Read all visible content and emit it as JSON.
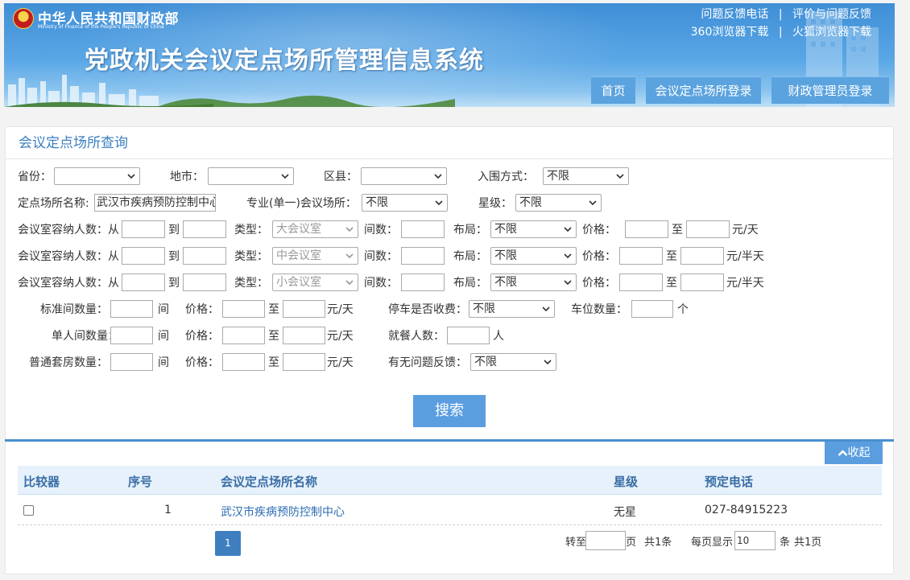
{
  "header": {
    "ministry_cn": "中华人民共和国财政部",
    "ministry_en": "Ministry of Finance of the People's Republic of China",
    "system_title": "党政机关会议定点场所管理信息系统",
    "links_row1": [
      "问题反馈电话",
      "评价与问题反馈"
    ],
    "links_row2": [
      "360浏览器下载",
      "火狐浏览器下载"
    ],
    "separator": "|",
    "nav": [
      "首页",
      "会议定点场所登录",
      "财政管理员登录"
    ]
  },
  "query": {
    "title": "会议定点场所查询",
    "row1": {
      "province_label": "省份：",
      "province_value": "",
      "city_label": "地市：",
      "city_value": "",
      "district_label": "区县：",
      "district_value": "",
      "entry_label": "入围方式：",
      "entry_value": "不限"
    },
    "row2": {
      "name_label": "定点场所名称:",
      "name_value": "武汉市疾病预防控制中心",
      "special_label": "专业(单一)会议场所：",
      "special_value": "不限",
      "star_label": "星级：",
      "star_value": "不限"
    },
    "rooms": [
      {
        "cap_label": "会议室容纳人数：从",
        "to": "到",
        "type_label": "类型：",
        "type_value": "大会议室",
        "count_label": "间数：",
        "layout_label": "布局：",
        "layout_value": "不限",
        "price_label": "价格：",
        "price_to": "至",
        "unit": "元/天"
      },
      {
        "cap_label": "会议室容纳人数：从",
        "to": "到",
        "type_label": "类型：",
        "type_value": "中会议室",
        "count_label": "间数：",
        "layout_label": "布局：",
        "layout_value": "不限",
        "price_label": "价格：",
        "price_to": "至",
        "unit": "元/半天"
      },
      {
        "cap_label": "会议室容纳人数：从",
        "to": "到",
        "type_label": "类型：",
        "type_value": "小会议室",
        "count_label": "间数：",
        "layout_label": "布局：",
        "layout_value": "不限",
        "price_label": "价格：",
        "price_to": "至",
        "unit": "元/半天"
      }
    ],
    "lodging": [
      {
        "label": "标准间数量：",
        "unit": "间",
        "price_label": "价格：",
        "price_to": "至",
        "price_unit": "元/天"
      },
      {
        "label": "单人间数量：",
        "unit": "间",
        "price_label": "价格：",
        "price_to": "至",
        "price_unit": "元/天"
      },
      {
        "label": "普通套房数量：",
        "unit": "间",
        "price_label": "价格：",
        "price_to": "至",
        "price_unit": "元/天"
      }
    ],
    "parking_fee_label": "停车是否收费：",
    "parking_fee_value": "不限",
    "parking_spaces_label": "车位数量：",
    "parking_spaces_unit": "个",
    "dining_label": "就餐人数：",
    "dining_unit": "人",
    "feedback_label": "有无问题反馈：",
    "feedback_value": "不限",
    "search_button": "搜索"
  },
  "results": {
    "collapse_label": "收起",
    "columns": [
      "比较器",
      "序号",
      "会议定点场所名称",
      "星级",
      "预定电话"
    ],
    "rows": [
      {
        "index": "1",
        "name": "武汉市疾病预防控制中心",
        "star": "无星",
        "phone": "027-84915223"
      }
    ],
    "pagination": {
      "current_page": "1",
      "goto_label": "转至",
      "page_unit": "页",
      "total_records": "共1条",
      "per_page_label": "每页显示",
      "per_page_value": "10",
      "per_page_unit": "条",
      "total_pages": "共1页"
    }
  }
}
